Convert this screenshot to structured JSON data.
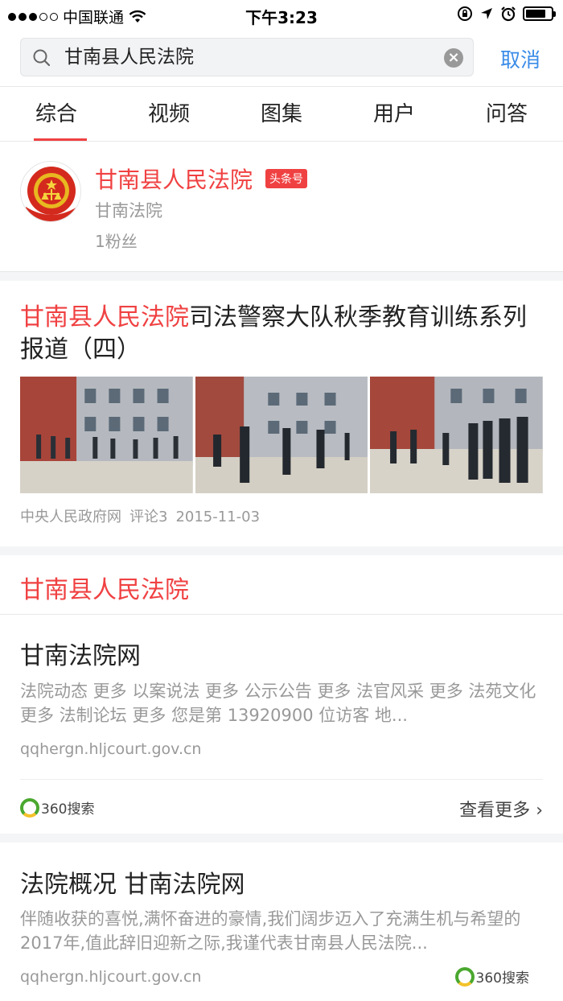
{
  "status_bar": {
    "carrier": "中国联通",
    "time": "下午3:23",
    "battery_level": 0.8
  },
  "search": {
    "query": "甘南县人民法院",
    "cancel_label": "取消"
  },
  "tabs": [
    {
      "label": "综合",
      "active": true
    },
    {
      "label": "视频",
      "active": false
    },
    {
      "label": "图集",
      "active": false
    },
    {
      "label": "用户",
      "active": false
    },
    {
      "label": "问答",
      "active": false
    }
  ],
  "account": {
    "name": "甘南县人民法院",
    "badge": "头条号",
    "desc": "甘南法院",
    "fans": "1粉丝"
  },
  "article": {
    "title_highlight": "甘南县人民法院",
    "title_rest": "司法警察大队秋季教育训练系列报道（四）",
    "source": "中央人民政府网",
    "comments": "评论3",
    "date": "2015-11-03"
  },
  "web_result": {
    "header": "甘南县人民法院",
    "title": "甘南法院网",
    "snippet": "法院动态 更多 以案说法 更多 公示公告 更多 法官风采 更多 法苑文化 更多 法制论坛 更多 您是第 13920900 位访客 地...",
    "url": "qqhergn.hljcourt.gov.cn",
    "engine": "360搜索",
    "more_label": "查看更多"
  },
  "web_result2": {
    "title": "法院概况 甘南法院网",
    "snippet": "伴随收获的喜悦,满怀奋进的豪情,我们阔步迈入了充满生机与希望的2017年,值此辞旧迎新之际,我谨代表甘南县人民法院...",
    "url": "qqhergn.hljcourt.gov.cn",
    "engine": "360搜索"
  },
  "colors": {
    "accent": "#f04142",
    "link": "#3b8ce8",
    "muted": "#999999"
  }
}
